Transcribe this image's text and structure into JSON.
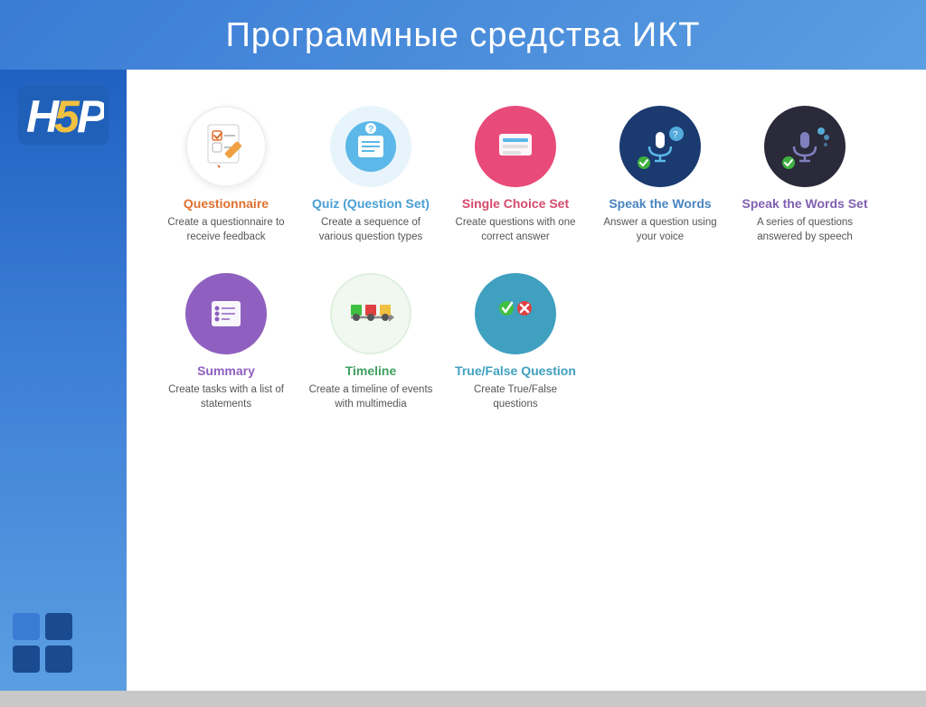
{
  "header": {
    "title": "Программные средства ИКТ"
  },
  "logo": {
    "text": "H5P"
  },
  "items": [
    {
      "id": "questionnaire",
      "title": "Questionnaire",
      "desc": "Create a questionnaire to receive feedback",
      "iconClass": "ic-questionnaire",
      "titleClass": "tc-questionnaire"
    },
    {
      "id": "quiz",
      "title": "Quiz (Question Set)",
      "desc": "Create a sequence of various question types",
      "iconClass": "ic-quiz",
      "titleClass": "tc-quiz"
    },
    {
      "id": "singlechoice",
      "title": "Single Choice Set",
      "desc": "Create questions with one correct answer",
      "iconClass": "ic-singlechoice",
      "titleClass": "tc-singlechoice"
    },
    {
      "id": "speakwords",
      "title": "Speak the Words",
      "desc": "Answer a question using your voice",
      "iconClass": "ic-speakwords",
      "titleClass": "tc-speakwords"
    },
    {
      "id": "speakwordsset",
      "title": "Speak the Words Set",
      "desc": "A series of questions answered by speech",
      "iconClass": "ic-speakwordsset",
      "titleClass": "tc-speakwordsset"
    },
    {
      "id": "summary",
      "title": "Summary",
      "desc": "Create tasks with a list of statements",
      "iconClass": "ic-summary",
      "titleClass": "tc-summary"
    },
    {
      "id": "timeline",
      "title": "Timeline",
      "desc": "Create a timeline of events with multimedia",
      "iconClass": "ic-timeline",
      "titleClass": "tc-timeline"
    },
    {
      "id": "truefalse",
      "title": "True/False Question",
      "desc": "Create True/False questions",
      "iconClass": "ic-truefalse",
      "titleClass": "tc-truefalse"
    }
  ]
}
